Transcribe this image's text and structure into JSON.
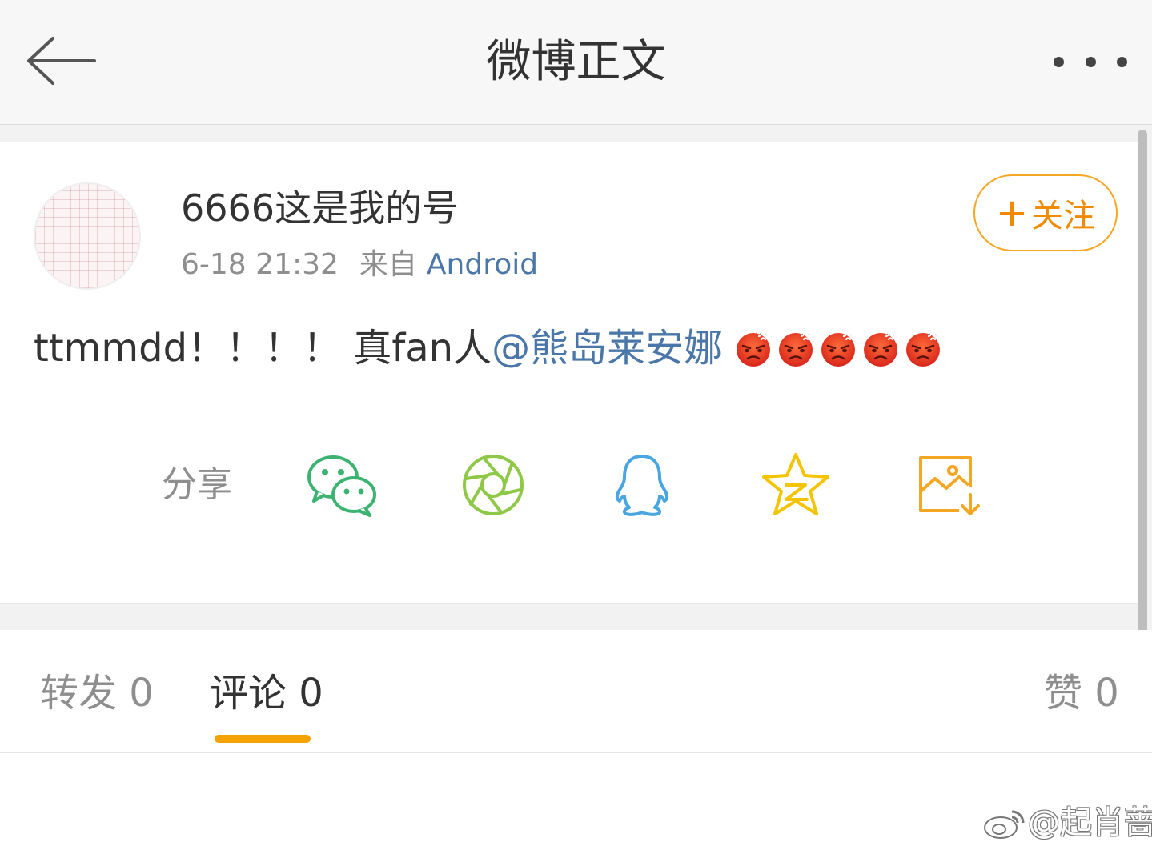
{
  "header": {
    "title": "微博正文",
    "back_icon": "arrow-left-icon",
    "more_icon": "more-dots-icon"
  },
  "post": {
    "username": "6666这是我的号",
    "time": "6-18 21:32",
    "from_label": "来自",
    "source": "Android",
    "follow_label": "关注",
    "text_prefix": "ttmmdd！！！！ 真fan人",
    "mention": "@熊岛莱安娜",
    "emoji_name": "angry-face-emoji",
    "emoji_count": 5
  },
  "share": {
    "label": "分享",
    "icons": [
      "wechat-icon",
      "moments-icon",
      "qq-icon",
      "qzone-icon",
      "save-image-icon"
    ]
  },
  "tabs": {
    "repost": "转发 0",
    "comment": "评论 0",
    "like": "赞 0"
  },
  "colors": {
    "accent": "#f5a200",
    "link": "#4a77a8",
    "wechat": "#3cb371",
    "moments": "#8fc846",
    "qq": "#4aa6e0",
    "qzone": "#f5c400",
    "save": "#f5a623"
  },
  "watermark": "@起肖蔷"
}
